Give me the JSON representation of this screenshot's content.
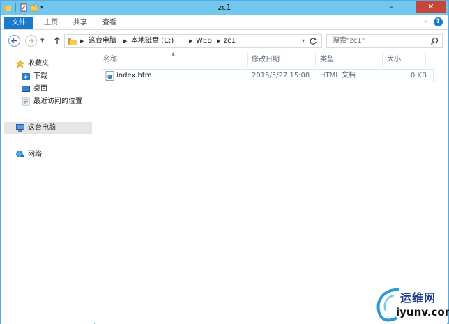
{
  "window": {
    "title": "zc1",
    "controls": {
      "minimize": "–",
      "maximize": "□",
      "close": "✕"
    }
  },
  "ribbon": {
    "file_tab": "文件",
    "tabs": [
      "主页",
      "共享",
      "查看"
    ],
    "help": "?",
    "expand": "⌄"
  },
  "address_bar": {
    "crumbs": [
      "这台电脑",
      "本地磁盘 (C:)",
      "WEB",
      "zc1"
    ],
    "separator": "▶"
  },
  "search": {
    "placeholder": "搜索\"zc1\""
  },
  "nav_pane": {
    "favorites": {
      "label": "收藏夹",
      "items": [
        "下载",
        "桌面",
        "最近访问的位置"
      ]
    },
    "this_pc": "这台电脑",
    "network": "网络"
  },
  "columns": {
    "name": "名称",
    "modified": "修改日期",
    "type": "类型",
    "size": "大小"
  },
  "files": [
    {
      "name": "index.htm",
      "modified": "2015/5/27 15:08",
      "type": "HTML 文档",
      "size": "0 KB"
    }
  ],
  "watermark": {
    "cn": "运维网",
    "en": "iyunv.com"
  },
  "colors": {
    "titlebar": "#72c7ee",
    "file_tab": "#1979ca",
    "close_button": "#c7463a",
    "selection": "#cde8ff"
  }
}
